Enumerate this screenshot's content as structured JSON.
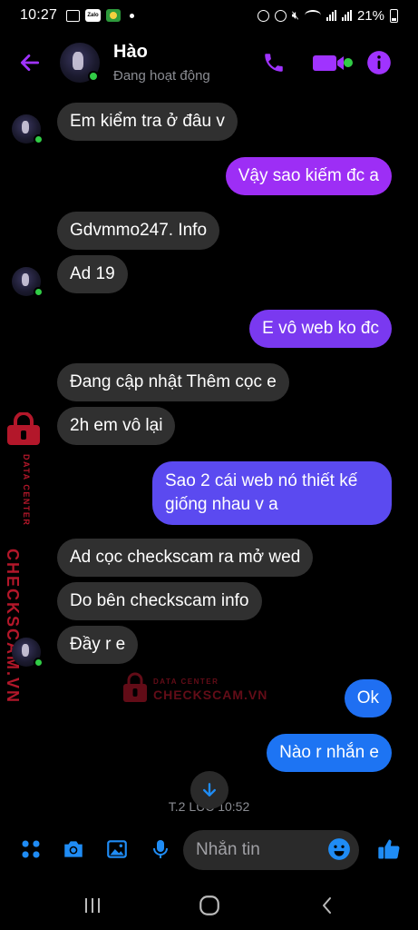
{
  "status_bar": {
    "time": "10:27",
    "zalo_label": "Zalo",
    "battery": "21%"
  },
  "header": {
    "name": "Hào",
    "status": "Đang hoạt động",
    "accent_color": "#a033ff",
    "online_color": "#31cc46"
  },
  "messages": [
    {
      "side": "in",
      "text": "Em kiểm tra ở đâu v"
    },
    {
      "side": "out",
      "text": "Vậy sao kiếm đc a",
      "color": "#9d2ef5"
    },
    {
      "side": "in",
      "text": "Gdvmmo247. Info"
    },
    {
      "side": "in",
      "text": "Ad 19"
    },
    {
      "side": "out",
      "text": "E vô web ko đc",
      "color": "#7a39f0"
    },
    {
      "side": "in",
      "text": "Đang cập nhật Thêm cọc e"
    },
    {
      "side": "in",
      "text": "2h em vô lại"
    },
    {
      "side": "out",
      "text_line1": "Sao 2 cái web nó thiết kế",
      "text_line2": "giống nhau v a",
      "color": "#5b4af0"
    },
    {
      "side": "in",
      "text": "Ad cọc checkscam ra mở wed"
    },
    {
      "side": "in",
      "text": "Do bên checkscam info"
    },
    {
      "side": "in",
      "text": "Đầy r e"
    },
    {
      "side": "out",
      "text": "Ok",
      "color": "#1f6ff2"
    },
    {
      "side": "out",
      "text": "Nào r nhắn e",
      "color": "#1d74f3"
    }
  ],
  "timestamp": "T.2 LÚC 10:52",
  "watermark": {
    "side_top": "DATA CENTER",
    "side_main": "CHECKSCAM.VN",
    "center_top": "DATA CENTER",
    "center_main": "CHECKSCAM.VN",
    "color": "#b3172a"
  },
  "composer": {
    "placeholder": "Nhắn tin",
    "icon_color": "#1f8cf5",
    "icons": [
      "apps-icon",
      "camera-icon",
      "image-icon",
      "mic-icon",
      "emoji-icon",
      "like-icon"
    ]
  },
  "nav_bar": {
    "icons": [
      "recents-icon",
      "home-icon",
      "back-icon"
    ]
  }
}
